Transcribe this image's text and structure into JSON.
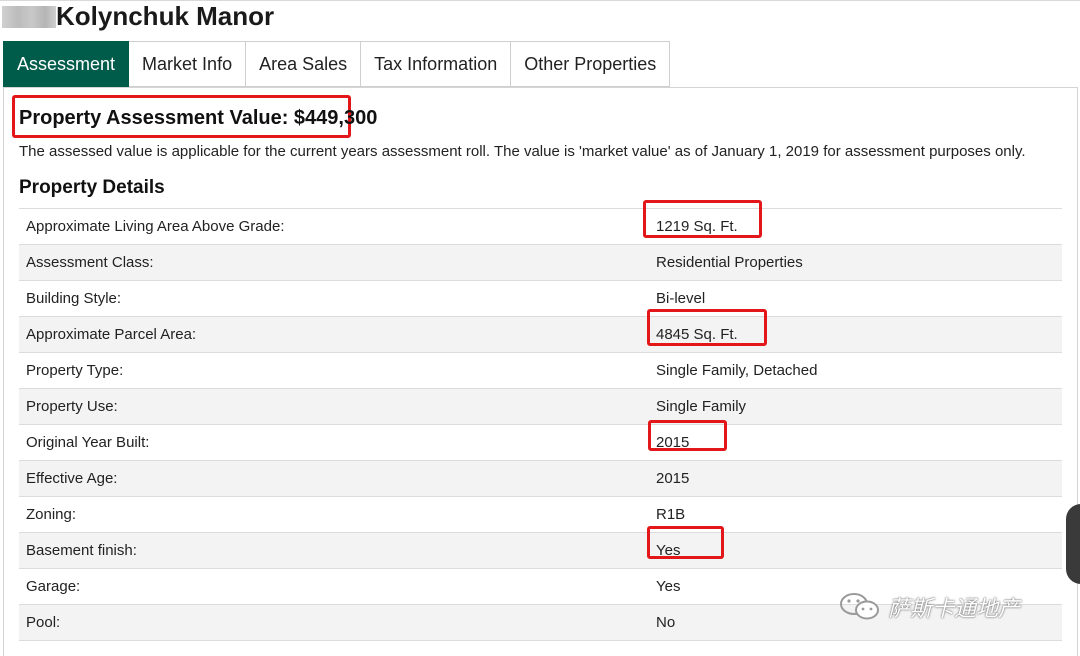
{
  "page": {
    "title": "Kolynchuk Manor"
  },
  "tabs": [
    {
      "label": "Assessment",
      "active": true
    },
    {
      "label": "Market Info",
      "active": false
    },
    {
      "label": "Area Sales",
      "active": false
    },
    {
      "label": "Tax Information",
      "active": false
    },
    {
      "label": "Other Properties",
      "active": false
    }
  ],
  "assessment": {
    "value_line": "Property Assessment Value: $449,300",
    "note": "The assessed value is applicable for the current years assessment roll. The value is 'market value' as of January 1, 2019 for assessment purposes only."
  },
  "details": {
    "heading": "Property Details",
    "rows": [
      {
        "label": "Approximate Living Area Above Grade:",
        "value": "1219 Sq. Ft.",
        "highlighted": true
      },
      {
        "label": "Assessment Class:",
        "value": "Residential Properties",
        "highlighted": false
      },
      {
        "label": "Building Style:",
        "value": "Bi-level",
        "highlighted": false
      },
      {
        "label": "Approximate Parcel Area:",
        "value": "4845 Sq. Ft.",
        "highlighted": true
      },
      {
        "label": "Property Type:",
        "value": "Single Family, Detached",
        "highlighted": false
      },
      {
        "label": "Property Use:",
        "value": "Single Family",
        "highlighted": false
      },
      {
        "label": "Original Year Built:",
        "value": "2015",
        "highlighted": true
      },
      {
        "label": "Effective Age:",
        "value": "2015",
        "highlighted": false
      },
      {
        "label": "Zoning:",
        "value": "R1B",
        "highlighted": false
      },
      {
        "label": "Basement finish:",
        "value": "Yes",
        "highlighted": true
      },
      {
        "label": "Garage:",
        "value": "Yes",
        "highlighted": false
      },
      {
        "label": "Pool:",
        "value": "No",
        "highlighted": false
      }
    ]
  },
  "watermark": {
    "text": "萨斯卡通地产",
    "icon": "wechat-icon"
  },
  "colors": {
    "tab_active_bg": "#005c4a",
    "highlight_border": "#e3161a"
  }
}
